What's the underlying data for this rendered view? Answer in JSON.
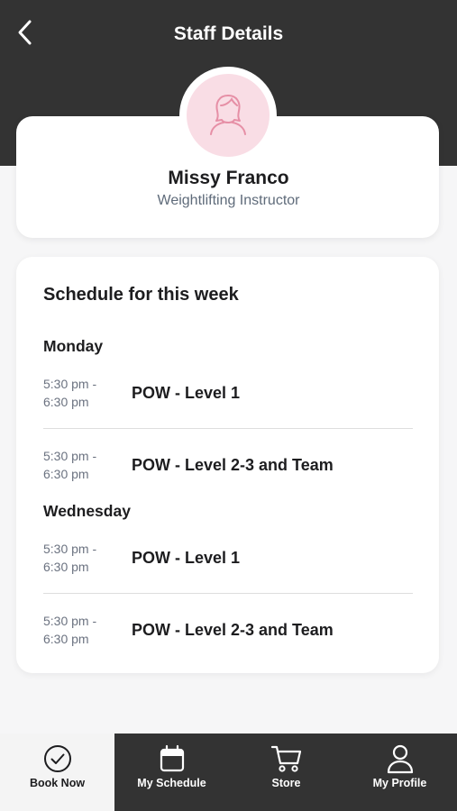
{
  "header": {
    "title": "Staff Details",
    "back_icon": "chevron-left-icon"
  },
  "staff": {
    "name": "Missy Franco",
    "role": "Weightlifting Instructor",
    "avatar_icon": "woman-avatar-icon"
  },
  "schedule": {
    "title": "Schedule for this week",
    "days": [
      {
        "day": "Monday",
        "classes": [
          {
            "time_start": "5:30 pm -",
            "time_end": "6:30 pm",
            "name": "POW - Level 1"
          },
          {
            "time_start": "5:30 pm -",
            "time_end": "6:30 pm",
            "name": "POW - Level 2-3 and Team"
          }
        ]
      },
      {
        "day": "Wednesday",
        "classes": [
          {
            "time_start": "5:30 pm -",
            "time_end": "6:30 pm",
            "name": "POW - Level 1"
          },
          {
            "time_start": "5:30 pm -",
            "time_end": "6:30 pm",
            "name": "POW - Level 2-3 and Team"
          }
        ]
      }
    ]
  },
  "nav": {
    "items": [
      {
        "label": "Book Now",
        "icon": "check-circle-icon",
        "active": true
      },
      {
        "label": "My Schedule",
        "icon": "calendar-icon",
        "active": false
      },
      {
        "label": "Store",
        "icon": "cart-icon",
        "active": false
      },
      {
        "label": "My Profile",
        "icon": "user-icon",
        "active": false
      }
    ]
  },
  "colors": {
    "header_bg": "#333333",
    "nav_bg": "#333333",
    "avatar_bg": "#f9dde5",
    "avatar_accent": "#e68fa6",
    "page_bg": "#f6f6f7"
  }
}
